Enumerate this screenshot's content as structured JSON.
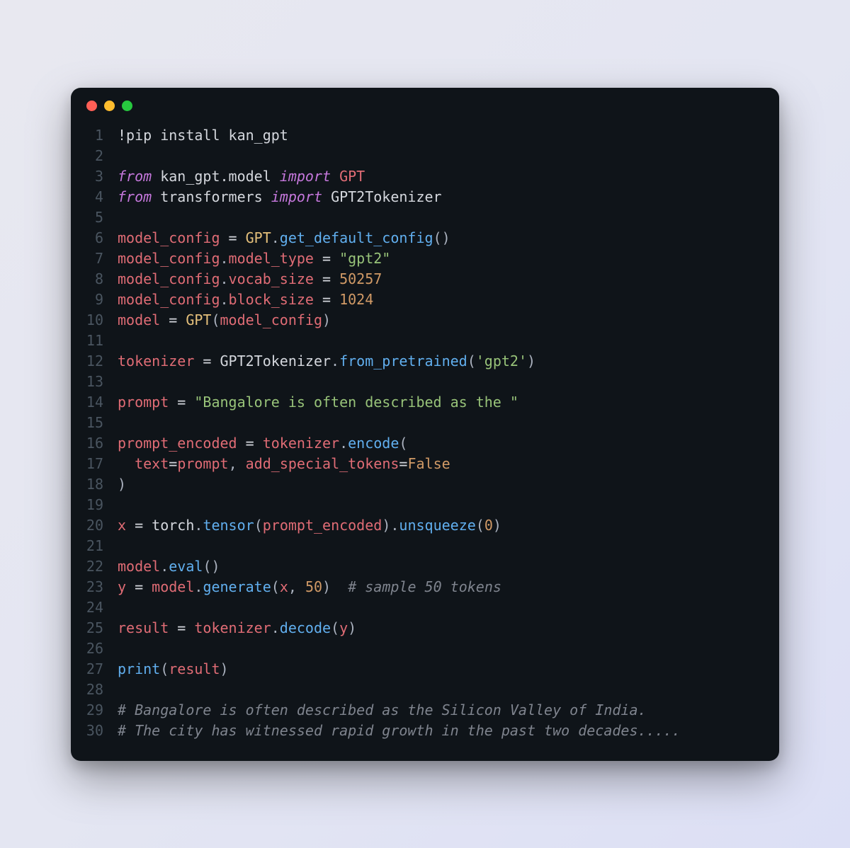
{
  "traffic_lights": [
    "red",
    "yellow",
    "green"
  ],
  "code": {
    "lines": [
      {
        "n": 1,
        "tokens": [
          [
            "!pip install kan_gpt",
            "tok-default"
          ]
        ]
      },
      {
        "n": 2,
        "tokens": []
      },
      {
        "n": 3,
        "tokens": [
          [
            "from ",
            "tok-keyword"
          ],
          [
            "kan_gpt.model ",
            "tok-default"
          ],
          [
            "import ",
            "tok-keyword"
          ],
          [
            "GPT",
            "tok-ident-red"
          ]
        ]
      },
      {
        "n": 4,
        "tokens": [
          [
            "from ",
            "tok-keyword"
          ],
          [
            "transformers ",
            "tok-default"
          ],
          [
            "import ",
            "tok-keyword"
          ],
          [
            "GPT2Tokenizer",
            "tok-default"
          ]
        ]
      },
      {
        "n": 5,
        "tokens": []
      },
      {
        "n": 6,
        "tokens": [
          [
            "model_config",
            "tok-ident-red"
          ],
          [
            " = ",
            "tok-operator"
          ],
          [
            "GPT",
            "tok-class"
          ],
          [
            ".",
            "tok-punc"
          ],
          [
            "get_default_config",
            "tok-ident-func"
          ],
          [
            "()",
            "tok-punc"
          ]
        ]
      },
      {
        "n": 7,
        "tokens": [
          [
            "model_config",
            "tok-ident-red"
          ],
          [
            ".",
            "tok-punc"
          ],
          [
            "model_type",
            "tok-ident-red"
          ],
          [
            " = ",
            "tok-operator"
          ],
          [
            "\"gpt2\"",
            "tok-string"
          ]
        ]
      },
      {
        "n": 8,
        "tokens": [
          [
            "model_config",
            "tok-ident-red"
          ],
          [
            ".",
            "tok-punc"
          ],
          [
            "vocab_size",
            "tok-ident-red"
          ],
          [
            " = ",
            "tok-operator"
          ],
          [
            "50257",
            "tok-number"
          ]
        ]
      },
      {
        "n": 9,
        "tokens": [
          [
            "model_config",
            "tok-ident-red"
          ],
          [
            ".",
            "tok-punc"
          ],
          [
            "block_size",
            "tok-ident-red"
          ],
          [
            " = ",
            "tok-operator"
          ],
          [
            "1024",
            "tok-number"
          ]
        ]
      },
      {
        "n": 10,
        "tokens": [
          [
            "model",
            "tok-ident-red"
          ],
          [
            " = ",
            "tok-operator"
          ],
          [
            "GPT",
            "tok-class"
          ],
          [
            "(",
            "tok-punc"
          ],
          [
            "model_config",
            "tok-ident-red"
          ],
          [
            ")",
            "tok-punc"
          ]
        ]
      },
      {
        "n": 11,
        "tokens": []
      },
      {
        "n": 12,
        "tokens": [
          [
            "tokenizer",
            "tok-ident-red"
          ],
          [
            " = ",
            "tok-operator"
          ],
          [
            "GPT2Tokenizer",
            "tok-default"
          ],
          [
            ".",
            "tok-punc"
          ],
          [
            "from_pretrained",
            "tok-ident-func"
          ],
          [
            "(",
            "tok-punc"
          ],
          [
            "'gpt2'",
            "tok-string"
          ],
          [
            ")",
            "tok-punc"
          ]
        ]
      },
      {
        "n": 13,
        "tokens": []
      },
      {
        "n": 14,
        "tokens": [
          [
            "prompt",
            "tok-ident-red"
          ],
          [
            " = ",
            "tok-operator"
          ],
          [
            "\"Bangalore is often described as the \"",
            "tok-string"
          ]
        ]
      },
      {
        "n": 15,
        "tokens": []
      },
      {
        "n": 16,
        "tokens": [
          [
            "prompt_encoded",
            "tok-ident-red"
          ],
          [
            " = ",
            "tok-operator"
          ],
          [
            "tokenizer",
            "tok-ident-red"
          ],
          [
            ".",
            "tok-punc"
          ],
          [
            "encode",
            "tok-ident-func"
          ],
          [
            "(",
            "tok-punc"
          ]
        ]
      },
      {
        "n": 17,
        "tokens": [
          [
            "  ",
            "tok-default"
          ],
          [
            "text",
            "tok-ident-red"
          ],
          [
            "=",
            "tok-operator"
          ],
          [
            "prompt",
            "tok-ident-red"
          ],
          [
            ", ",
            "tok-punc"
          ],
          [
            "add_special_tokens",
            "tok-ident-red"
          ],
          [
            "=",
            "tok-operator"
          ],
          [
            "False",
            "tok-const"
          ]
        ]
      },
      {
        "n": 18,
        "tokens": [
          [
            ")",
            "tok-punc"
          ]
        ]
      },
      {
        "n": 19,
        "tokens": []
      },
      {
        "n": 20,
        "tokens": [
          [
            "x",
            "tok-ident-red"
          ],
          [
            " = ",
            "tok-operator"
          ],
          [
            "torch",
            "tok-default"
          ],
          [
            ".",
            "tok-punc"
          ],
          [
            "tensor",
            "tok-ident-func"
          ],
          [
            "(",
            "tok-punc"
          ],
          [
            "prompt_encoded",
            "tok-ident-red"
          ],
          [
            ")",
            "tok-punc"
          ],
          [
            ".",
            "tok-punc"
          ],
          [
            "unsqueeze",
            "tok-ident-func"
          ],
          [
            "(",
            "tok-punc"
          ],
          [
            "0",
            "tok-number"
          ],
          [
            ")",
            "tok-punc"
          ]
        ]
      },
      {
        "n": 21,
        "tokens": []
      },
      {
        "n": 22,
        "tokens": [
          [
            "model",
            "tok-ident-red"
          ],
          [
            ".",
            "tok-punc"
          ],
          [
            "eval",
            "tok-ident-func"
          ],
          [
            "()",
            "tok-punc"
          ]
        ]
      },
      {
        "n": 23,
        "tokens": [
          [
            "y",
            "tok-ident-red"
          ],
          [
            " = ",
            "tok-operator"
          ],
          [
            "model",
            "tok-ident-red"
          ],
          [
            ".",
            "tok-punc"
          ],
          [
            "generate",
            "tok-ident-func"
          ],
          [
            "(",
            "tok-punc"
          ],
          [
            "x",
            "tok-ident-red"
          ],
          [
            ", ",
            "tok-punc"
          ],
          [
            "50",
            "tok-number"
          ],
          [
            ")",
            "tok-punc"
          ],
          [
            "  ",
            "tok-default"
          ],
          [
            "# sample 50 tokens",
            "tok-comment"
          ]
        ]
      },
      {
        "n": 24,
        "tokens": []
      },
      {
        "n": 25,
        "tokens": [
          [
            "result",
            "tok-ident-red"
          ],
          [
            " = ",
            "tok-operator"
          ],
          [
            "tokenizer",
            "tok-ident-red"
          ],
          [
            ".",
            "tok-punc"
          ],
          [
            "decode",
            "tok-ident-func"
          ],
          [
            "(",
            "tok-punc"
          ],
          [
            "y",
            "tok-ident-red"
          ],
          [
            ")",
            "tok-punc"
          ]
        ]
      },
      {
        "n": 26,
        "tokens": []
      },
      {
        "n": 27,
        "tokens": [
          [
            "print",
            "tok-ident-func"
          ],
          [
            "(",
            "tok-punc"
          ],
          [
            "result",
            "tok-ident-red"
          ],
          [
            ")",
            "tok-punc"
          ]
        ]
      },
      {
        "n": 28,
        "tokens": []
      },
      {
        "n": 29,
        "tokens": [
          [
            "# Bangalore is often described as the Silicon Valley of India.",
            "tok-comment"
          ]
        ]
      },
      {
        "n": 30,
        "tokens": [
          [
            "# The city has witnessed rapid growth in the past two decades.....",
            "tok-comment"
          ]
        ]
      }
    ]
  }
}
